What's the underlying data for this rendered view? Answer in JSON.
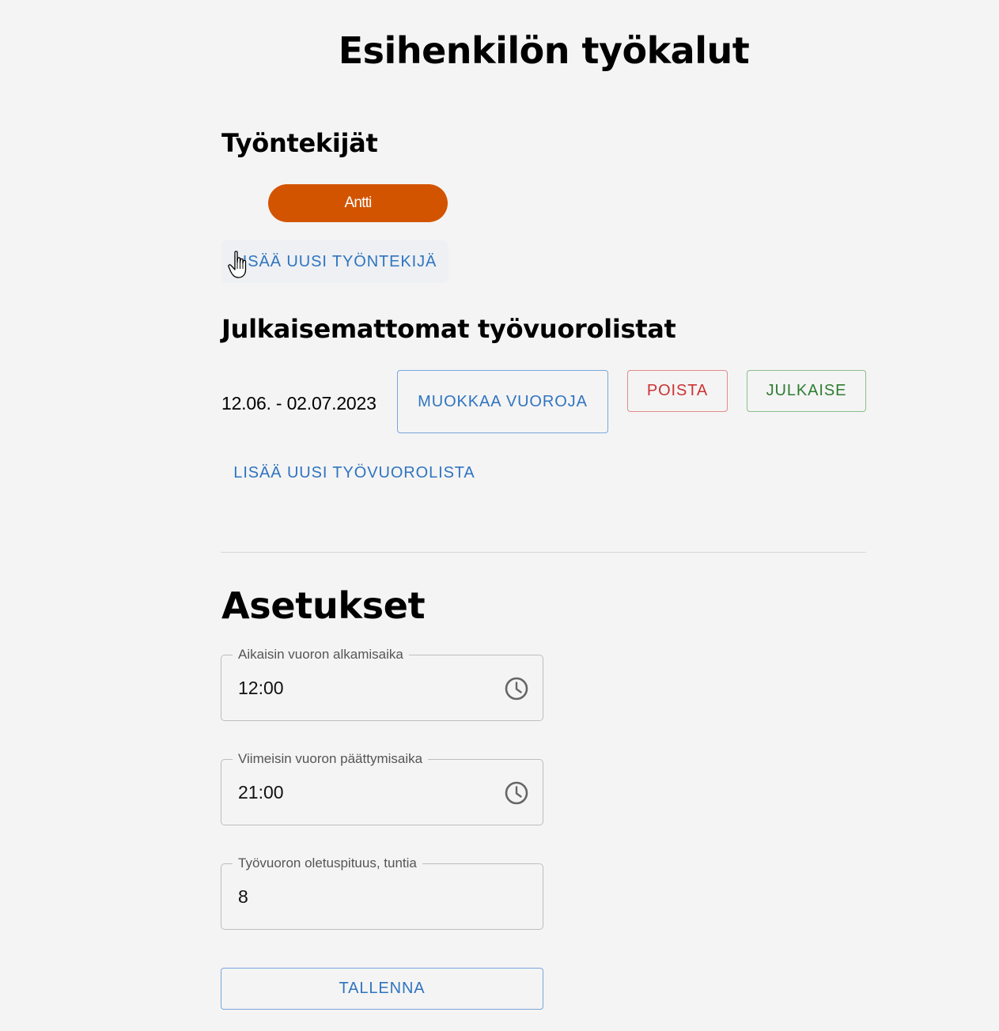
{
  "page_title": "Esihenkilön työkalut",
  "employees": {
    "heading": "Työntekijät",
    "list": [
      "Antti"
    ],
    "add_label": "LISÄÄ UUSI TYÖNTEKIJÄ"
  },
  "unpublished": {
    "heading": "Julkaisemattomat työvuorolistat",
    "rosters": [
      {
        "date_range": "12.06. - 02.07.2023",
        "edit_label": "MUOKKAA VUOROJA",
        "delete_label": "POISTA",
        "publish_label": "JULKAISE"
      }
    ],
    "add_label": "LISÄÄ UUSI TYÖVUOROLISTA"
  },
  "settings": {
    "heading": "Asetukset",
    "earliest_start": {
      "label": "Aikaisin vuoron alkamisaika",
      "value": "12:00",
      "icon": "clock-icon"
    },
    "latest_end": {
      "label": "Viimeisin vuoron päättymisaika",
      "value": "21:00",
      "icon": "clock-icon"
    },
    "default_length": {
      "label": "Työvuoron oletuspituus, tuntia",
      "value": "8"
    },
    "save_label": "TALLENNA"
  },
  "colors": {
    "accent": "#d35400",
    "primary": "#2f74c0",
    "danger": "#cc3333",
    "success": "#2e7d32",
    "background": "#f4f4f4"
  }
}
